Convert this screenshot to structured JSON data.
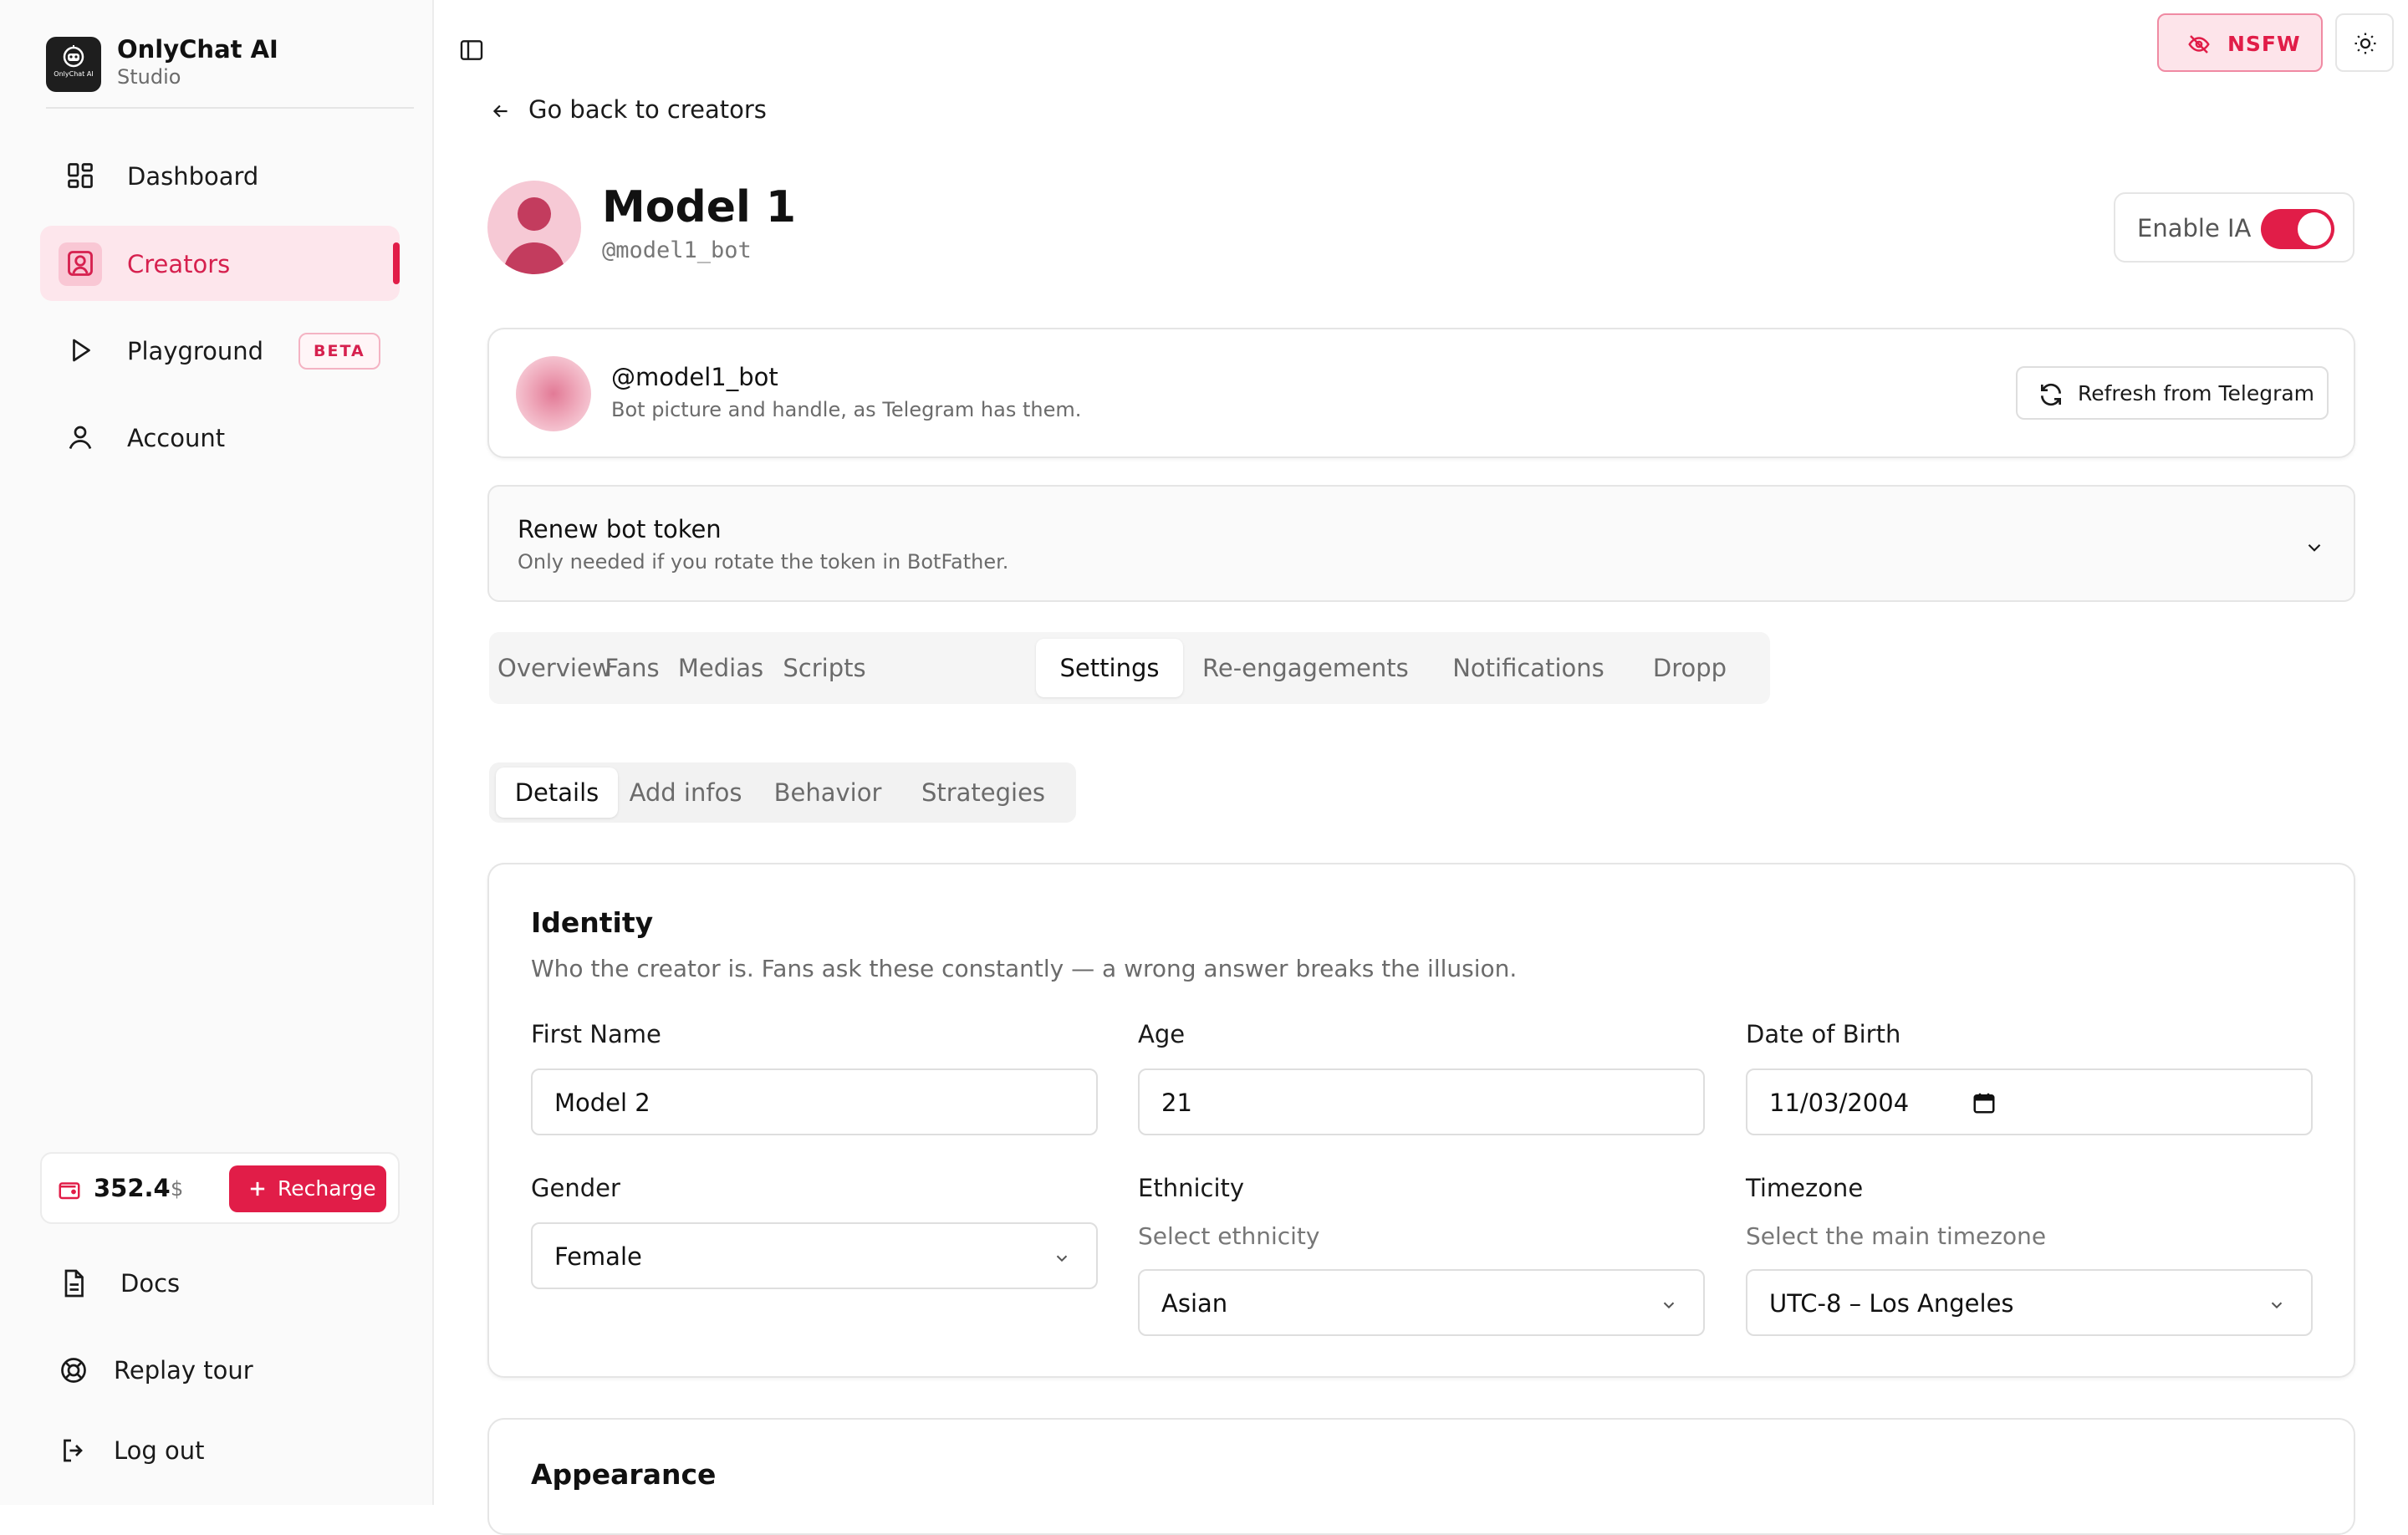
{
  "brand": {
    "name": "OnlyChat AI",
    "subtitle": "Studio",
    "logo_text": "OnlyChat AI"
  },
  "sidebar": {
    "items": [
      {
        "label": "Dashboard",
        "icon": "grid-icon"
      },
      {
        "label": "Creators",
        "icon": "user-square-icon",
        "active": true
      },
      {
        "label": "Playground",
        "icon": "play-icon",
        "badge": "BETA"
      },
      {
        "label": "Account",
        "icon": "user-icon"
      }
    ],
    "balance": {
      "amount": "352.4",
      "currency": "$",
      "recharge_label": "Recharge"
    },
    "footer": [
      {
        "label": "Docs",
        "icon": "document-icon"
      },
      {
        "label": "Replay tour",
        "icon": "lifebuoy-icon"
      },
      {
        "label": "Log out",
        "icon": "logout-icon"
      }
    ]
  },
  "header": {
    "nsfw_label": "NSFW",
    "back_label": "Go back to creators"
  },
  "creator": {
    "name": "Model 1",
    "handle": "@model1_bot",
    "enable_label": "Enable IA",
    "enabled": true
  },
  "bot_card": {
    "handle": "@model1_bot",
    "description": "Bot picture and handle, as Telegram has them.",
    "refresh_label": "Refresh from Telegram"
  },
  "renew": {
    "title": "Renew bot token",
    "description": "Only needed if you rotate the token in BotFather."
  },
  "tabs": [
    "Overview",
    "Fans",
    "Medias",
    "Scripts",
    "Settings",
    "Re-engagements",
    "Notifications",
    "Dropp"
  ],
  "active_tab": "Settings",
  "subtabs": [
    "Details",
    "Add infos",
    "Behavior",
    "Strategies"
  ],
  "active_subtab": "Details",
  "identity": {
    "title": "Identity",
    "description": "Who the creator is. Fans ask these constantly — a wrong answer breaks the illusion.",
    "first_name": {
      "label": "First Name",
      "value": "Model 2"
    },
    "age": {
      "label": "Age",
      "value": "21"
    },
    "dob": {
      "label": "Date of Birth",
      "value": "11/03/2004"
    },
    "gender": {
      "label": "Gender",
      "value": "Female"
    },
    "ethnicity": {
      "label": "Ethnicity",
      "hint": "Select ethnicity",
      "value": "Asian"
    },
    "timezone": {
      "label": "Timezone",
      "hint": "Select the main timezone",
      "value": "UTC-8 – Los Angeles"
    }
  },
  "appearance": {
    "title": "Appearance"
  },
  "colors": {
    "accent": "#e11d48",
    "accent_soft": "#fde6ec",
    "text": "#111111",
    "muted": "#6b6b6b",
    "border": "#e5e5e5"
  }
}
